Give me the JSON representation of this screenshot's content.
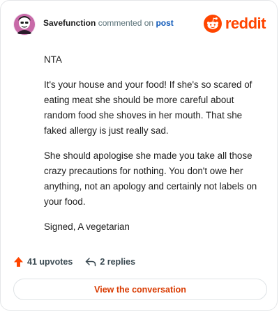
{
  "header": {
    "username": "Savefunction",
    "action_text": "commented on",
    "post_link": "post",
    "brand": "reddit"
  },
  "comment": {
    "paragraphs": [
      "NTA",
      "It's your house and your food! If she's so scared of eating meat she should be more careful about random food she shoves in her mouth. That she faked allergy is just really sad.",
      "She should apologise she made you take all those crazy precautions for nothing. You don't owe her anything, not an apology and certainly not labels on your food.",
      "Signed, A vegetarian"
    ]
  },
  "footer": {
    "upvotes": "41 upvotes",
    "replies": "2 replies"
  },
  "cta": {
    "label": "View the conversation"
  },
  "colors": {
    "brand": "#ff4500",
    "link": "#0a56b8",
    "cta_text": "#d93a00"
  },
  "icons": [
    "avatar",
    "reddit-logo-icon",
    "upvote-arrow-icon",
    "reply-arrow-icon"
  ]
}
